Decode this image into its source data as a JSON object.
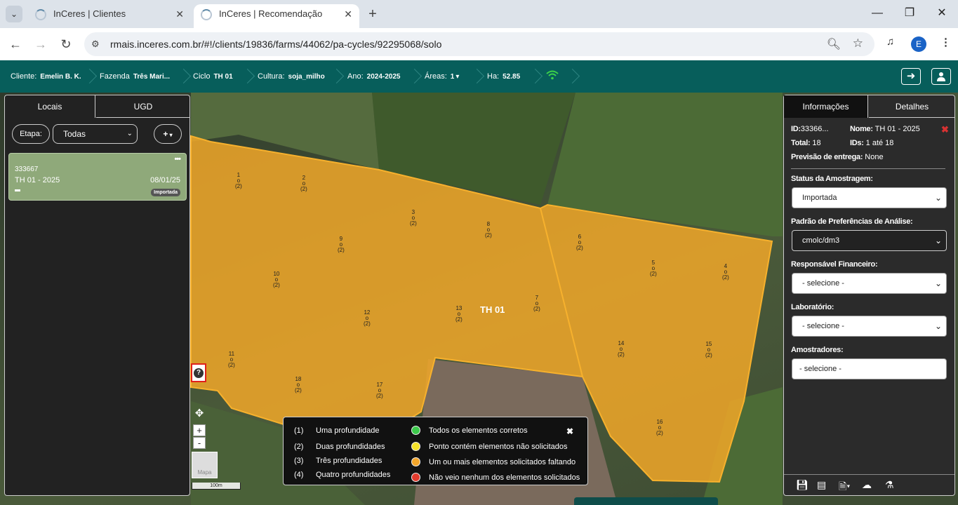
{
  "browser": {
    "tabs": [
      {
        "title": "InCeres | Clientes"
      },
      {
        "title": "InCeres | Recomendação"
      }
    ],
    "url": "rmais.inceres.com.br/#!/clients/19836/farms/44062/pa-cycles/92295068/solo",
    "profile_initial": "E"
  },
  "header": {
    "cliente_label": "Cliente:",
    "cliente_value": "Emelin B. K.",
    "fazenda_label": "Fazenda",
    "fazenda_value": "Três Mari...",
    "ciclo_label": "Ciclo",
    "ciclo_value": "TH 01",
    "cultura_label": "Cultura:",
    "cultura_value": "soja_milho",
    "ano_label": "Ano:",
    "ano_value": "2024-2025",
    "areas_label": "Áreas:",
    "areas_value": "1",
    "ha_label": "Ha:",
    "ha_value": "52.85"
  },
  "left_panel": {
    "tabs": [
      "Locais",
      "UGD"
    ],
    "etapa_label": "Etapa:",
    "etapa_value": "Todas",
    "add_label": "+",
    "card": {
      "id": "333667",
      "name": "TH 01 - 2025",
      "date": "08/01/25",
      "badge": "Importada"
    }
  },
  "right_panel": {
    "tabs": [
      "Informações",
      "Detalhes"
    ],
    "id_label": "ID:",
    "id_value": "33366...",
    "nome_label": "Nome:",
    "nome_value": "TH 01 - 2025",
    "total_label": "Total:",
    "total_value": "18",
    "ids_label": "IDs:",
    "ids_value": "1 até 18",
    "previsao_label": "Previsão de entrega:",
    "previsao_value": "None",
    "status_label": "Status da Amostragem:",
    "status_value": "Importada",
    "padrao_label": "Padrão de Preferências de Análise:",
    "padrao_value": "cmolc/dm3",
    "responsavel_label": "Responsável Financeiro:",
    "responsavel_value": "- selecione -",
    "laboratorio_label": "Laboratório:",
    "laboratorio_value": "- selecione -",
    "amostradores_label": "Amostradores:",
    "amostradores_value": "- selecione -"
  },
  "map": {
    "field_label": "TH 01",
    "points": [
      {
        "n": "1",
        "d": "(2)"
      },
      {
        "n": "2",
        "d": "(2)"
      },
      {
        "n": "3",
        "d": "(2)"
      },
      {
        "n": "4",
        "d": "(2)"
      },
      {
        "n": "5",
        "d": "(2)"
      },
      {
        "n": "6",
        "d": "(2)"
      },
      {
        "n": "7",
        "d": "(2)"
      },
      {
        "n": "8",
        "d": "(2)"
      },
      {
        "n": "9",
        "d": "(2)"
      },
      {
        "n": "10",
        "d": "(2)"
      },
      {
        "n": "11",
        "d": "(2)"
      },
      {
        "n": "12",
        "d": "(2)"
      },
      {
        "n": "13",
        "d": "(2)"
      },
      {
        "n": "14",
        "d": "(2)"
      },
      {
        "n": "15",
        "d": "(2)"
      },
      {
        "n": "16",
        "d": "(2)"
      },
      {
        "n": "17",
        "d": "(2)"
      },
      {
        "n": "18",
        "d": "(2)"
      }
    ],
    "zoom_in": "+",
    "zoom_out": "-",
    "layer_label": "Mapa",
    "scale": "100m",
    "field_color": "#f0a629"
  },
  "legend": {
    "depths": [
      {
        "num": "(1)",
        "label": "Uma profundidade"
      },
      {
        "num": "(2)",
        "label": "Duas profundidades"
      },
      {
        "num": "(3)",
        "label": "Três profundidades"
      },
      {
        "num": "(4)",
        "label": "Quatro profundidades"
      }
    ],
    "statuses": [
      {
        "color": "#3cc94b",
        "label": "Todos os elementos corretos"
      },
      {
        "color": "#f4e12a",
        "label": "Ponto contém elementos não solicitados"
      },
      {
        "color": "#f2a52a",
        "label": "Um ou mais elementos solicitados faltando"
      },
      {
        "color": "#e23b2e",
        "label": "Não veio nenhum dos elementos solicitados"
      }
    ]
  }
}
